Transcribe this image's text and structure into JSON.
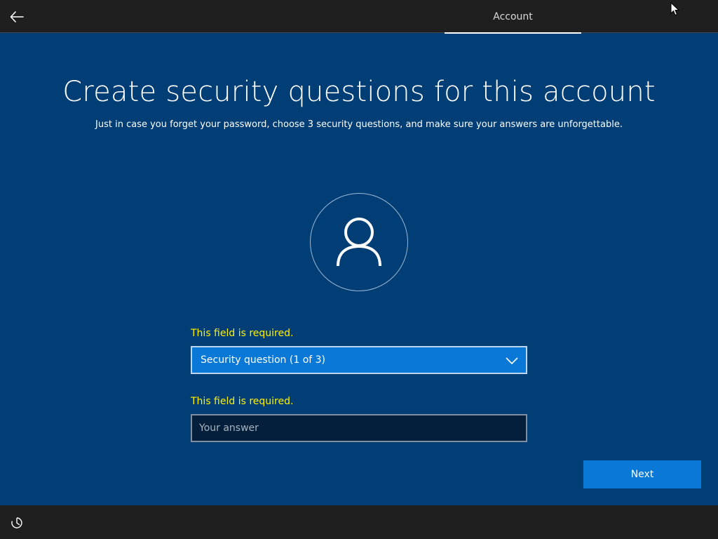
{
  "topbar": {
    "back_icon": "back-arrow-icon",
    "tab_account_label": "Account"
  },
  "main": {
    "title": "Create security questions for this account",
    "subtitle": "Just in case you forget your password, choose 3 security questions, and make sure your answers are unforgettable.",
    "avatar_icon": "user-icon"
  },
  "form": {
    "question_error": "This field is required.",
    "question_selected": "Security question (1 of 3)",
    "answer_error": "This field is required.",
    "answer_value": "",
    "answer_placeholder": "Your answer",
    "next_label": "Next"
  },
  "bottombar": {
    "ease_icon": "ease-of-access-icon"
  },
  "colors": {
    "background": "#023e76",
    "bar": "#1f1f1f",
    "accent": "#0a78d6",
    "error": "#fff200"
  }
}
